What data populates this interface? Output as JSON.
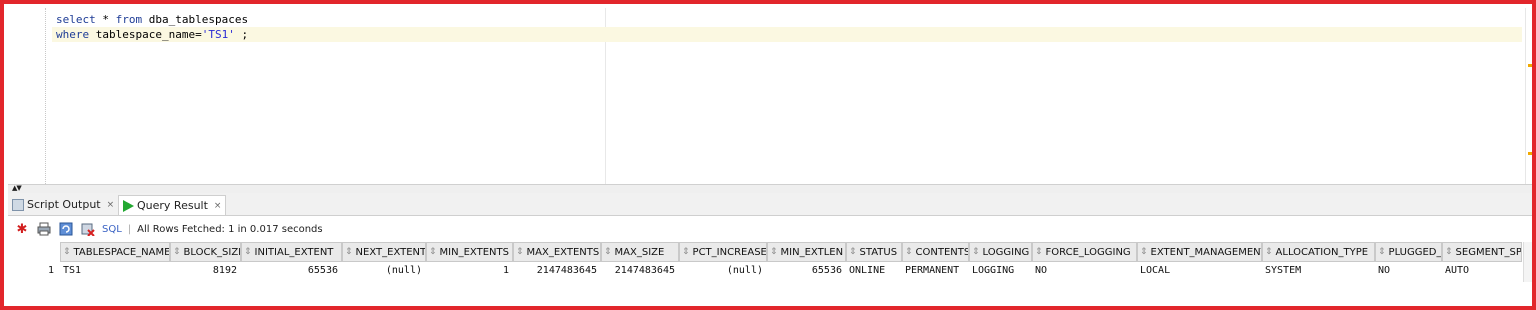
{
  "editor": {
    "lines": [
      {
        "kw1": "select",
        "rest1": " * ",
        "kw2": "from",
        "rest2": " dba_tablespaces"
      },
      {
        "kw1": "where",
        "rest1": " tablespace_name=",
        "str": "'TS1'",
        "rest2": " ;"
      }
    ]
  },
  "tabs": [
    {
      "label": "Script Output",
      "icon": "script-output-icon",
      "close": "×"
    },
    {
      "label": "Query Result",
      "icon": "run-icon",
      "close": "×"
    }
  ],
  "toolbar": {
    "sql_label": "SQL",
    "separator": "|",
    "status": "All Rows Fetched: 1 in 0.017 seconds"
  },
  "grid": {
    "sort_glyph": "⇕",
    "columns": [
      "TABLESPACE_NAME",
      "BLOCK_SIZE",
      "INITIAL_EXTENT",
      "NEXT_EXTENT",
      "MIN_EXTENTS",
      "MAX_EXTENTS",
      "MAX_SIZE",
      "PCT_INCREASE",
      "MIN_EXTLEN",
      "STATUS",
      "CONTENTS",
      "LOGGING",
      "FORCE_LOGGING",
      "EXTENT_MANAGEMENT",
      "ALLOCATION_TYPE",
      "PLUGGED_IN",
      "SEGMENT_SP"
    ],
    "rows": [
      {
        "num": "1",
        "values": [
          "TS1",
          "8192",
          "65536",
          "(null)",
          "1",
          "2147483645",
          "2147483645",
          "(null)",
          "65536",
          "ONLINE",
          "PERMANENT",
          "LOGGING",
          "NO",
          "LOCAL",
          "SYSTEM",
          "NO",
          "AUTO"
        ]
      }
    ]
  },
  "colors": {
    "frame": "#e2262b",
    "keyword": "#1e3c96",
    "string": "#2b2bd4",
    "highlight": "#fbf8e1"
  }
}
